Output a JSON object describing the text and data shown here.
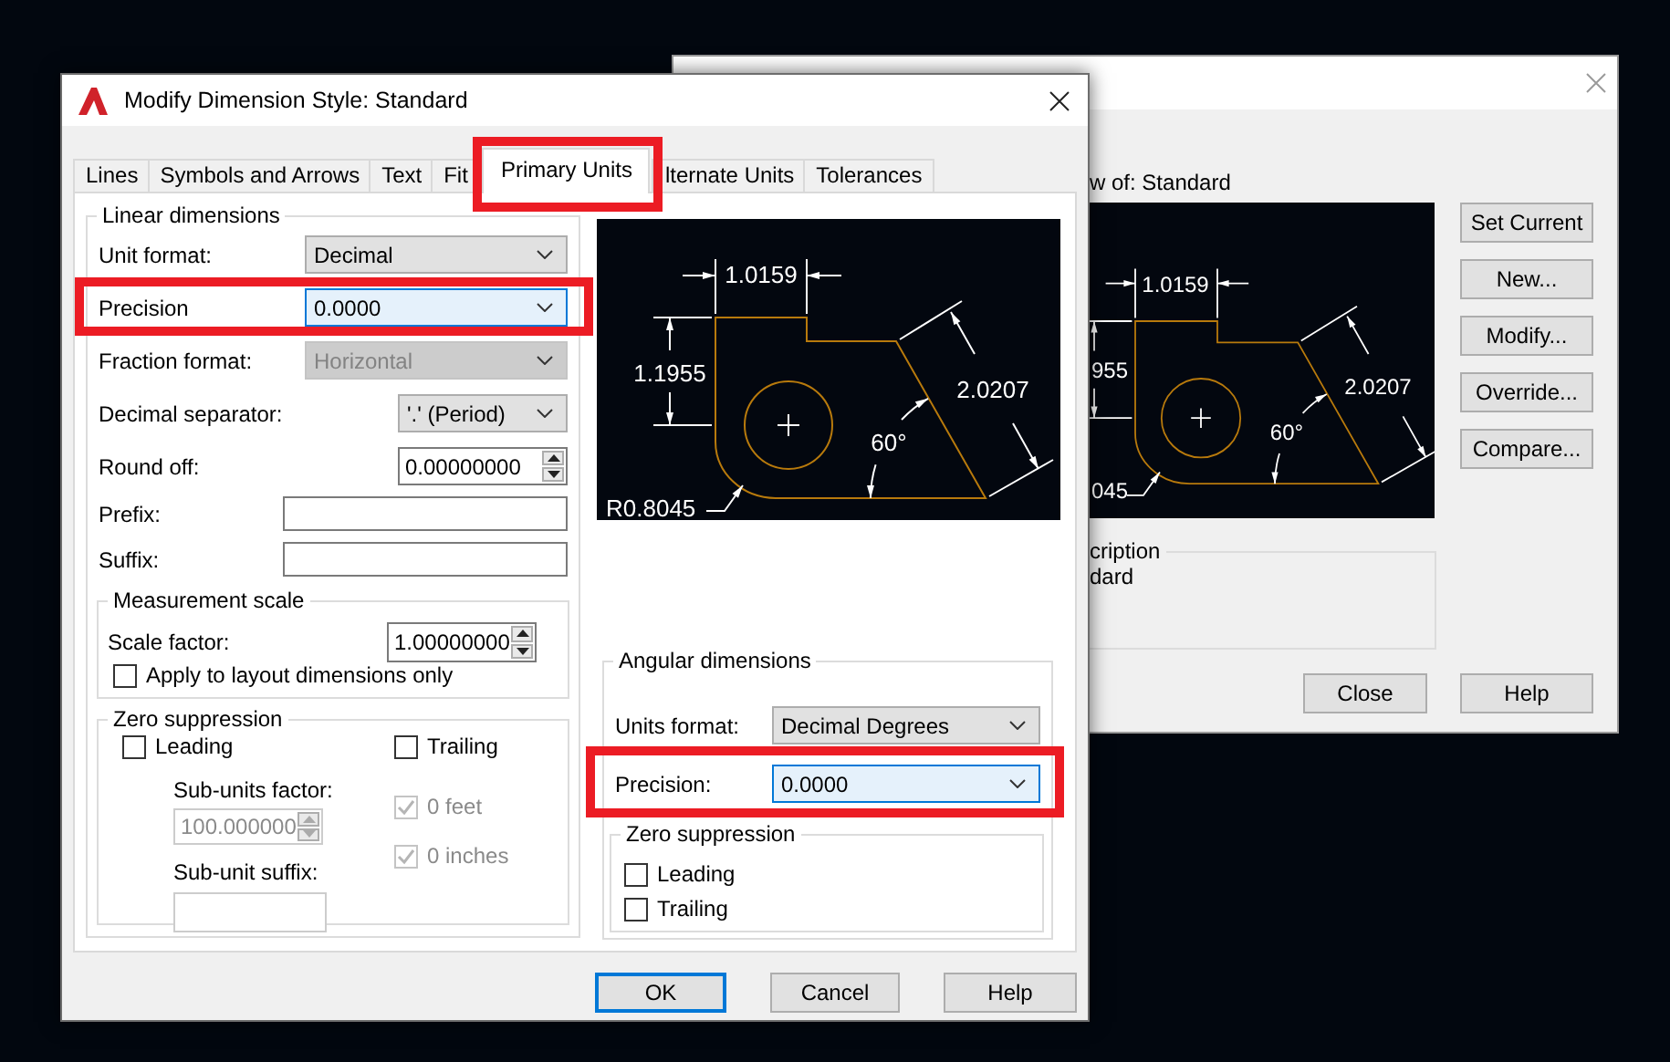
{
  "window": {
    "title": "Modify Dimension Style: Standard",
    "tabs": [
      {
        "label": "Lines",
        "selected": false,
        "highlighted": false
      },
      {
        "label": "Symbols and Arrows",
        "selected": false,
        "highlighted": false
      },
      {
        "label": "Text",
        "selected": false,
        "highlighted": false
      },
      {
        "label": "Fit",
        "selected": false,
        "highlighted": false
      },
      {
        "label": "Primary Units",
        "selected": true,
        "highlighted": true
      },
      {
        "label": "lternate Units",
        "selected": false,
        "highlighted": false
      },
      {
        "label": "Tolerances",
        "selected": false,
        "highlighted": false
      }
    ],
    "linear_dimensions": {
      "legend": "Linear dimensions",
      "fields": [
        {
          "label": "Unit format:",
          "kind": "combo",
          "value": "Decimal",
          "focused": false,
          "disabled": false,
          "highlighted": false
        },
        {
          "label": "Precision",
          "kind": "combo",
          "value": "0.0000",
          "focused": true,
          "disabled": false,
          "highlighted": true
        },
        {
          "label": "Fraction format:",
          "kind": "combo",
          "value": "Horizontal",
          "focused": false,
          "disabled": true,
          "highlighted": false
        },
        {
          "label": "Decimal separator:",
          "kind": "combo",
          "value": "'.' (Period)",
          "focused": false,
          "disabled": false,
          "highlighted": false
        },
        {
          "label": "Round off:",
          "kind": "spinner",
          "value": "0.00000000",
          "focused": false,
          "disabled": false,
          "highlighted": false
        },
        {
          "label": "Prefix:",
          "kind": "text",
          "focused": false,
          "disabled": false,
          "highlighted": false
        },
        {
          "label": "Suffix:",
          "kind": "text",
          "focused": false,
          "disabled": false,
          "highlighted": false
        }
      ],
      "measurement_scale": {
        "legend": "Measurement scale",
        "scale_factor": {
          "label": "Scale factor:",
          "value": "1.00000000"
        },
        "layout_only": {
          "label": "Apply to layout dimensions only",
          "checked": false,
          "disabled": false
        }
      },
      "zero_suppression": {
        "legend": "Zero suppression",
        "checkboxes": [
          {
            "label": "Leading",
            "checked": false,
            "disabled": false
          },
          {
            "label": "Trailing",
            "checked": false,
            "disabled": false
          },
          {
            "label": "0 feet",
            "checked": true,
            "disabled": true
          },
          {
            "label": "0 inches",
            "checked": true,
            "disabled": true
          }
        ],
        "sub_units_factor": {
          "label": "Sub-units factor:",
          "value": "100.000000",
          "disabled": true
        },
        "sub_unit_suffix": {
          "label": "Sub-unit suffix:",
          "disabled": true
        }
      }
    },
    "preview": {
      "labels": [
        {
          "kind": "horizontal",
          "text": "1.0159"
        },
        {
          "kind": "vertical",
          "text": "1.1955"
        },
        {
          "kind": "aligned",
          "text": "2.0207"
        },
        {
          "kind": "angle",
          "text": "60°"
        },
        {
          "kind": "radius",
          "text": "R0.8045"
        }
      ]
    },
    "angular_dimensions": {
      "legend": "Angular dimensions",
      "fields": [
        {
          "label": "Units format:",
          "kind": "combo",
          "value": "Decimal Degrees",
          "focused": false,
          "disabled": false,
          "highlighted": false
        },
        {
          "label": "Precision:",
          "kind": "combo",
          "value": "0.0000",
          "focused": true,
          "disabled": false,
          "highlighted": true
        }
      ],
      "zero_suppression": {
        "legend": "Zero suppression",
        "checkboxes": [
          {
            "label": "Leading",
            "checked": false,
            "disabled": false
          },
          {
            "label": "Trailing",
            "checked": false,
            "disabled": false
          }
        ]
      }
    },
    "buttons": [
      {
        "label": "OK",
        "default": true
      },
      {
        "label": "Cancel",
        "default": false
      },
      {
        "label": "Help",
        "default": false
      }
    ]
  },
  "back_window": {
    "preview_caption": "w of: Standard",
    "preview": {
      "labels": [
        {
          "kind": "horizontal",
          "text": "1.0159"
        },
        {
          "kind": "vertical",
          "text": "955"
        },
        {
          "kind": "aligned",
          "text": "2.0207"
        },
        {
          "kind": "angle",
          "text": "60°"
        },
        {
          "kind": "radius",
          "text": "045"
        }
      ]
    },
    "description": {
      "legend": "cription",
      "text": "dard"
    },
    "side_buttons": [
      "Set Current",
      "New...",
      "Modify...",
      "Override...",
      "Compare..."
    ],
    "footer_buttons": [
      "Close",
      "Help"
    ]
  }
}
